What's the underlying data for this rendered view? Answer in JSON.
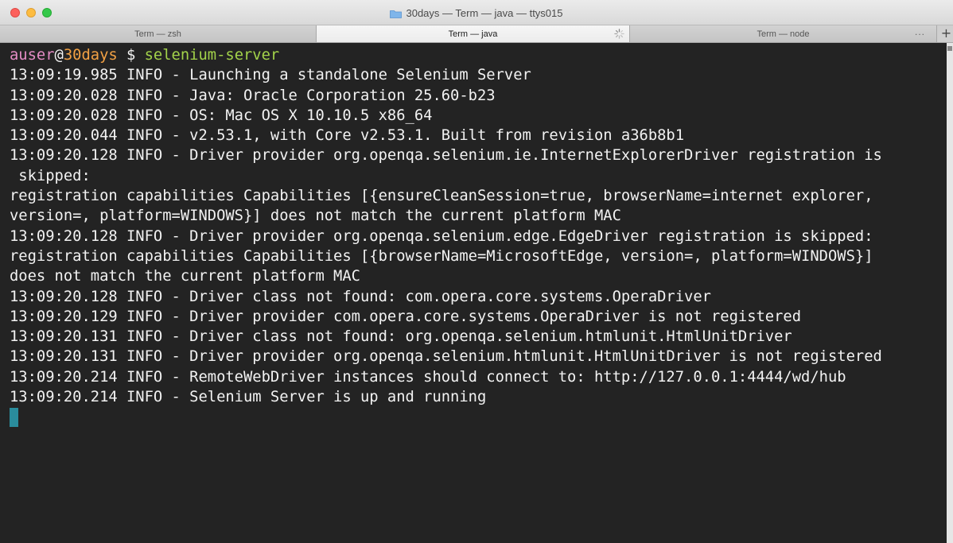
{
  "window": {
    "title": "30days — Term — java — ttys015"
  },
  "tabs": [
    {
      "label": "Term — zsh",
      "active": false
    },
    {
      "label": "Term — java",
      "active": true
    },
    {
      "label": "Term — node",
      "active": false
    }
  ],
  "tabbar": {
    "more_label": "...",
    "new_tab_label": "+"
  },
  "prompt": {
    "user": "auser",
    "at": "@",
    "host": "30days",
    "symbol": " $ ",
    "command": "selenium-server"
  },
  "output_lines": [
    "13:09:19.985 INFO - Launching a standalone Selenium Server",
    "13:09:20.028 INFO - Java: Oracle Corporation 25.60-b23",
    "13:09:20.028 INFO - OS: Mac OS X 10.10.5 x86_64",
    "13:09:20.044 INFO - v2.53.1, with Core v2.53.1. Built from revision a36b8b1",
    "13:09:20.128 INFO - Driver provider org.openqa.selenium.ie.InternetExplorerDriver registration is",
    " skipped:",
    "registration capabilities Capabilities [{ensureCleanSession=true, browserName=internet explorer,",
    "version=, platform=WINDOWS}] does not match the current platform MAC",
    "13:09:20.128 INFO - Driver provider org.openqa.selenium.edge.EdgeDriver registration is skipped:",
    "registration capabilities Capabilities [{browserName=MicrosoftEdge, version=, platform=WINDOWS}]",
    "does not match the current platform MAC",
    "13:09:20.128 INFO - Driver class not found: com.opera.core.systems.OperaDriver",
    "13:09:20.129 INFO - Driver provider com.opera.core.systems.OperaDriver is not registered",
    "13:09:20.131 INFO - Driver class not found: org.openqa.selenium.htmlunit.HtmlUnitDriver",
    "13:09:20.131 INFO - Driver provider org.openqa.selenium.htmlunit.HtmlUnitDriver is not registered",
    "13:09:20.214 INFO - RemoteWebDriver instances should connect to: http://127.0.0.1:4444/wd/hub",
    "13:09:20.214 INFO - Selenium Server is up and running"
  ],
  "colors": {
    "background": "#232323",
    "text": "#f2f2f2",
    "user": "#e48cc5",
    "host": "#f2a144",
    "command": "#a3d34a",
    "cursor": "#2a8c9c"
  },
  "icons": {
    "title": "folder-icon",
    "tab_activity": "spinner-icon",
    "close": "close-button",
    "minimize": "minimize-button",
    "maximize": "maximize-button"
  }
}
